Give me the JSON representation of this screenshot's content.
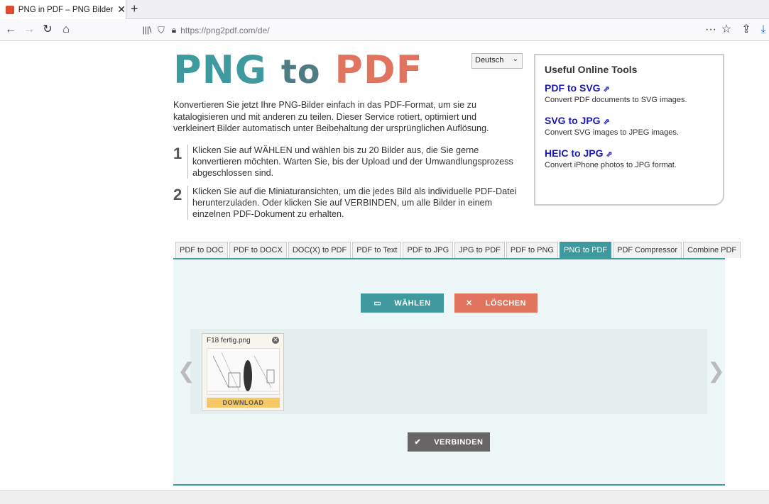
{
  "browser": {
    "tab_title": "PNG in PDF – PNG Bilder online",
    "url": "https://png2pdf.com/de/"
  },
  "logo": {
    "part1": "PNG",
    "part2": "to",
    "part3": "PDF"
  },
  "language": "Deutsch",
  "intro": "Konvertieren Sie jetzt Ihre PNG-Bilder einfach in das PDF-Format, um sie zu katalogisieren und mit anderen zu teilen. Dieser Service rotiert, optimiert und verkleinert Bilder automatisch unter Beibehaltung der ursprünglichen Auflösung.",
  "steps": [
    {
      "num": "1",
      "text": "Klicken Sie auf WÄHLEN und wählen bis zu 20 Bilder aus, die Sie gerne konvertieren möchten. Warten Sie, bis der Upload und der Umwandlungsprozess abgeschlossen sind."
    },
    {
      "num": "2",
      "text": "Klicken Sie auf die Miniaturansichten, um die jedes Bild als individuelle PDF-Datei herunterzuladen. Oder klicken Sie auf VERBINDEN, um alle Bilder in einem einzelnen PDF-Dokument zu erhalten."
    }
  ],
  "tools": {
    "heading": "Useful Online Tools",
    "items": [
      {
        "title": "PDF to SVG",
        "desc": "Convert PDF documents to SVG images."
      },
      {
        "title": "SVG to JPG",
        "desc": "Convert SVG images to JPEG images."
      },
      {
        "title": "HEIC to JPG",
        "desc": "Convert iPhone photos to JPG format."
      }
    ]
  },
  "format_tabs": [
    "PDF to DOC",
    "PDF to DOCX",
    "DOC(X) to PDF",
    "PDF to Text",
    "PDF to JPG",
    "JPG to PDF",
    "PDF to PNG",
    "PNG to PDF",
    "PDF Compressor",
    "Combine PDF"
  ],
  "active_tab": "PNG to PDF",
  "buttons": {
    "select": "WÄHLEN",
    "clear": "LÖSCHEN",
    "merge": "VERBINDEN"
  },
  "file": {
    "name": "F18 fertig.png",
    "download": "DOWNLOAD"
  },
  "colors": {
    "teal": "#3f9aa0",
    "salmon": "#e0745f",
    "gray_button": "#666666",
    "link": "#1a1aa6"
  }
}
